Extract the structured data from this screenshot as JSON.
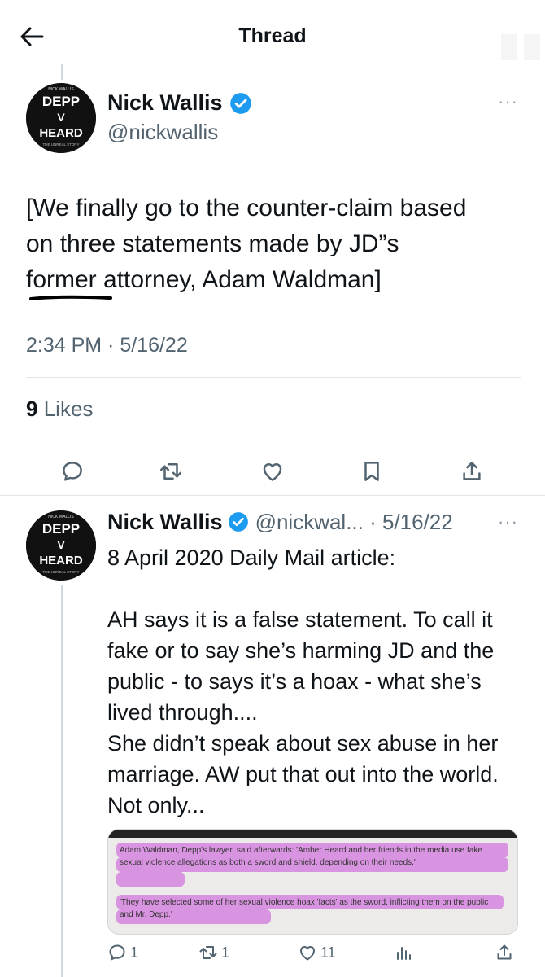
{
  "header": {
    "title": "Thread"
  },
  "main_tweet": {
    "author_name": "Nick Wallis",
    "handle": "@nickwallis",
    "text_lines": [
      "[We finally go to the counter-claim based",
      "on three statements made by JD”s",
      "former attorney, Adam Waldman]"
    ],
    "timestamp": "2:34 PM · 5/16/22",
    "likes_count": "9",
    "likes_label": "Likes"
  },
  "avatar": {
    "top": "NICK WALLIS",
    "line1": "DEPP",
    "line2": "V",
    "line3": "HEARD",
    "bottom": "THE UNREAL STORY"
  },
  "reply": {
    "author_name": "Nick Wallis",
    "handle_date": "@nickwal... · 5/16/22",
    "text": "8 April 2020 Daily Mail article:\n\nAH says it is a false statement. To call it fake or to say she’s harming JD and the public - to says it’s a hoax - what she’s lived through....\nShe didn’t speak about sex abuse in her marriage. AW put that out into the world. Not only...",
    "media_text_1": "Adam Waldman, Depp's lawyer, said afterwards: 'Amber Heard and her friends in the media use fake sexual violence allegations as both a sword and shield, depending on their needs.'",
    "media_text_2": "'They have selected some of her sexual violence hoax 'facts' as the sword, inflicting them on the public and Mr. Depp.'",
    "reply_count": "1",
    "retweet_count": "1",
    "like_count": "11"
  },
  "colors": {
    "verified": "#1d9bf0",
    "secondary": "#536471",
    "highlight": "#d78be0"
  },
  "icons": [
    "back-arrow-icon",
    "verified-icon",
    "more-icon",
    "reply-icon",
    "retweet-icon",
    "like-icon",
    "bookmark-icon",
    "share-icon",
    "views-icon"
  ]
}
